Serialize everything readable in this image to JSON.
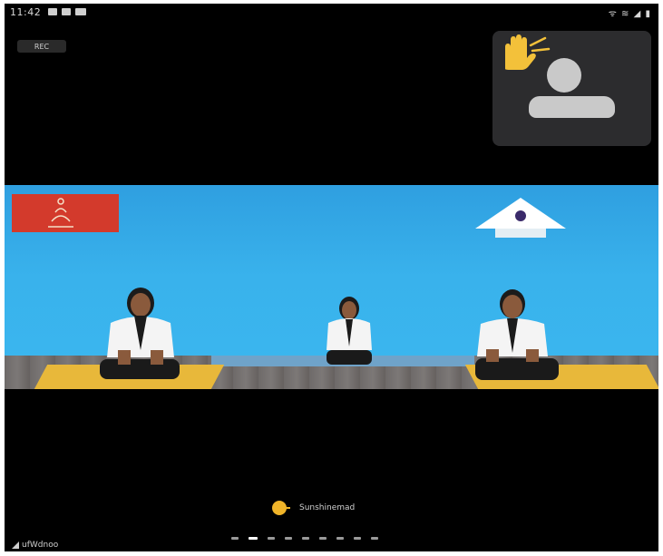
{
  "status_bar": {
    "time": "11:42",
    "right_icons": "ᯤ ≋ ◢ ▮"
  },
  "top_left_pill": {
    "label": "REC"
  },
  "self_view": {
    "reaction_icon": "raised-hand-icon",
    "avatar_icon": "person-avatar-icon",
    "tile_color": "#2c2c2e",
    "hand_color": "#f3c13a"
  },
  "main_video": {
    "wall_color": "#39b2ec",
    "mat_color": "#e8b83a",
    "banner_color": "#d33a2c"
  },
  "active_speaker": {
    "name": "Sunshinemad"
  },
  "page_indicator": {
    "count": 9,
    "active_index": 1
  },
  "bottom_left": {
    "label": "ufWdnoo"
  }
}
